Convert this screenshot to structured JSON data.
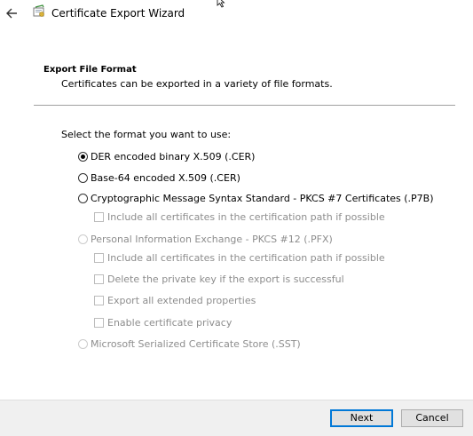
{
  "window": {
    "title": "Certificate Export Wizard"
  },
  "header": {
    "title": "Export File Format",
    "subtitle": "Certificates can be exported in a variety of file formats."
  },
  "prompt": "Select the format you want to use:",
  "options": [
    {
      "label": "DER encoded binary X.509 (.CER)",
      "kind": "radio",
      "checked": true,
      "enabled": true
    },
    {
      "label": "Base-64 encoded X.509 (.CER)",
      "kind": "radio",
      "checked": false,
      "enabled": true
    },
    {
      "label": "Cryptographic Message Syntax Standard - PKCS #7 Certificates (.P7B)",
      "kind": "radio",
      "checked": false,
      "enabled": true
    },
    {
      "label": "Include all certificates in the certification path if possible",
      "kind": "checkbox",
      "checked": false,
      "enabled": false
    },
    {
      "label": "Personal Information Exchange - PKCS #12 (.PFX)",
      "kind": "radio",
      "checked": false,
      "enabled": false
    },
    {
      "label": "Include all certificates in the certification path if possible",
      "kind": "checkbox",
      "checked": false,
      "enabled": false
    },
    {
      "label": "Delete the private key if the export is successful",
      "kind": "checkbox",
      "checked": false,
      "enabled": false
    },
    {
      "label": "Export all extended properties",
      "kind": "checkbox",
      "checked": false,
      "enabled": false
    },
    {
      "label": "Enable certificate privacy",
      "kind": "checkbox",
      "checked": false,
      "enabled": false
    },
    {
      "label": "Microsoft Serialized Certificate Store (.SST)",
      "kind": "radio",
      "checked": false,
      "enabled": false
    }
  ],
  "footer": {
    "next_label": "Next",
    "cancel_label": "Cancel"
  },
  "colors": {
    "accent": "#0078d7",
    "disabled_text": "#8d8d8d",
    "footer_bg": "#f0f0f0"
  },
  "icons": {
    "back": "back-arrow-icon",
    "wizard": "certificate-wizard-icon",
    "cursor": "mouse-pointer-icon"
  }
}
